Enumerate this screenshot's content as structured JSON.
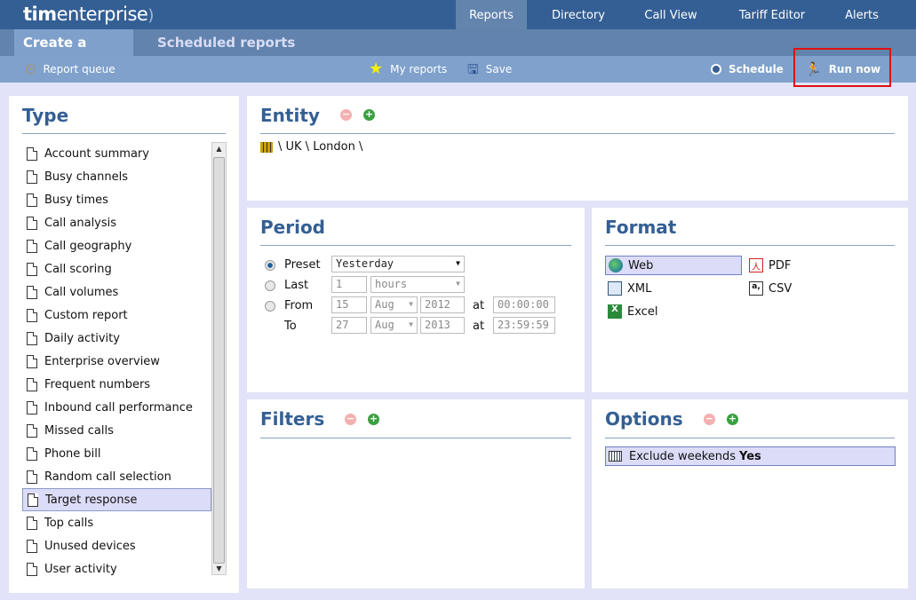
{
  "brand": {
    "logo_bold": "tim",
    "logo_rest": "enterprise"
  },
  "nav": [
    "Reports",
    "Directory",
    "Call View",
    "Tariff Editor",
    "Alerts"
  ],
  "subtabs": [
    "Create a report",
    "Scheduled reports"
  ],
  "toolbar": {
    "report_queue": "Report queue",
    "my_reports": "My reports",
    "save": "Save",
    "schedule": "Schedule",
    "run_now": "Run now"
  },
  "type": {
    "title": "Type",
    "items": [
      "Account summary",
      "Busy channels",
      "Busy times",
      "Call analysis",
      "Call geography",
      "Call scoring",
      "Call volumes",
      "Custom report",
      "Daily activity",
      "Enterprise overview",
      "Frequent numbers",
      "Inbound call performance",
      "Missed calls",
      "Phone bill",
      "Random call selection",
      "Target response",
      "Top calls",
      "Unused devices",
      "User activity"
    ],
    "selected": "Target response"
  },
  "entity": {
    "title": "Entity",
    "path": "\\ UK \\ London \\"
  },
  "period": {
    "title": "Period",
    "preset_label": "Preset",
    "preset_value": "Yesterday",
    "last_label": "Last",
    "last_value": "1",
    "last_unit": "hours",
    "from_label": "From",
    "from_day": "15",
    "from_month": "Aug",
    "from_year": "2012",
    "from_time": "00:00:00",
    "to_label": "To",
    "to_day": "27",
    "to_month": "Aug",
    "to_year": "2013",
    "to_time": "23:59:59",
    "at": "at",
    "selected": "Preset"
  },
  "format": {
    "title": "Format",
    "options": [
      "Web",
      "PDF",
      "XML",
      "CSV",
      "Excel"
    ],
    "selected": "Web"
  },
  "filters": {
    "title": "Filters"
  },
  "options": {
    "title": "Options",
    "item_label": "Exclude weekends",
    "item_value": "Yes"
  }
}
